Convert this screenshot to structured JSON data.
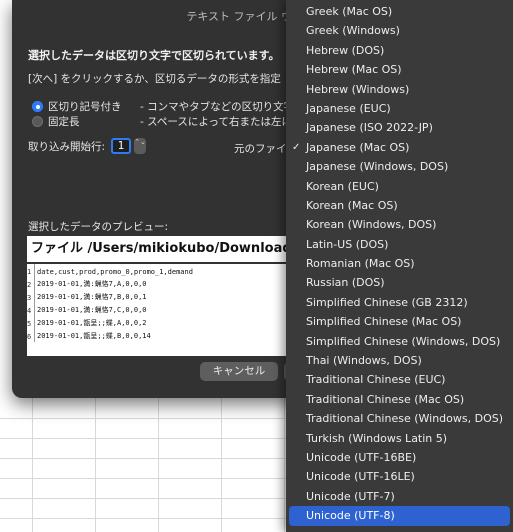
{
  "dialog": {
    "title": "テキスト ファイル ウ",
    "description_bold": "選択したデータは区切り文字で区切られています。",
    "description_line2": "[次へ] をクリックするか、区切るデータの形式を指定",
    "radio_options": [
      {
        "label": "区切り記号付き",
        "desc": "- コンマやタブなどの区切り文字",
        "selected": true
      },
      {
        "label": "固定長",
        "desc": "- スペースによって右または左に",
        "selected": false
      }
    ],
    "start_row_label": "取り込み開始行:",
    "start_row_value": "1",
    "stepper_symbol": "⌃⌄",
    "origin_label": "元のファイル",
    "preview_label": "選択したデータのプレビュー:",
    "preview_header": "ファイル /Users/mikiokubo/Downloads/dema",
    "preview_rows": [
      {
        "num": "1",
        "text": "date,cust,prod,promo_0,promo_1,demand"
      },
      {
        "num": "2",
        "text": "2019-01-01,満:蝋恪7,A,0,0,0"
      },
      {
        "num": "3",
        "text": "2019-01-01,満:蝋恪7,B,0,0,1"
      },
      {
        "num": "4",
        "text": "2019-01-01,満:蝋恪7,C,0,0,0"
      },
      {
        "num": "5",
        "text": "2019-01-01,甑呈;;蝶,A,0,0,2"
      },
      {
        "num": "6",
        "text": "2019-01-01,甑呈;;蝶,B,0,0,14"
      }
    ],
    "cancel_label": "キャンセル"
  },
  "menu": {
    "checkmark": "✓",
    "items": [
      {
        "label": "Greek (Mac OS)",
        "checked": false,
        "selected": false
      },
      {
        "label": "Greek (Windows)",
        "checked": false,
        "selected": false
      },
      {
        "label": "Hebrew (DOS)",
        "checked": false,
        "selected": false
      },
      {
        "label": "Hebrew (Mac OS)",
        "checked": false,
        "selected": false
      },
      {
        "label": "Hebrew (Windows)",
        "checked": false,
        "selected": false
      },
      {
        "label": "Japanese (EUC)",
        "checked": false,
        "selected": false
      },
      {
        "label": "Japanese (ISO 2022-JP)",
        "checked": false,
        "selected": false
      },
      {
        "label": "Japanese (Mac OS)",
        "checked": true,
        "selected": false
      },
      {
        "label": "Japanese (Windows, DOS)",
        "checked": false,
        "selected": false
      },
      {
        "label": "Korean (EUC)",
        "checked": false,
        "selected": false
      },
      {
        "label": "Korean (Mac OS)",
        "checked": false,
        "selected": false
      },
      {
        "label": "Korean (Windows, DOS)",
        "checked": false,
        "selected": false
      },
      {
        "label": "Latin-US (DOS)",
        "checked": false,
        "selected": false
      },
      {
        "label": "Romanian (Mac OS)",
        "checked": false,
        "selected": false
      },
      {
        "label": "Russian (DOS)",
        "checked": false,
        "selected": false
      },
      {
        "label": "Simplified Chinese (GB 2312)",
        "checked": false,
        "selected": false
      },
      {
        "label": "Simplified Chinese (Mac OS)",
        "checked": false,
        "selected": false
      },
      {
        "label": "Simplified Chinese (Windows, DOS)",
        "checked": false,
        "selected": false
      },
      {
        "label": "Thai (Windows, DOS)",
        "checked": false,
        "selected": false
      },
      {
        "label": "Traditional Chinese (EUC)",
        "checked": false,
        "selected": false
      },
      {
        "label": "Traditional Chinese (Mac OS)",
        "checked": false,
        "selected": false
      },
      {
        "label": "Traditional Chinese (Windows, DOS)",
        "checked": false,
        "selected": false
      },
      {
        "label": "Turkish (Windows Latin 5)",
        "checked": false,
        "selected": false
      },
      {
        "label": "Unicode (UTF-16BE)",
        "checked": false,
        "selected": false
      },
      {
        "label": "Unicode (UTF-16LE)",
        "checked": false,
        "selected": false
      },
      {
        "label": "Unicode (UTF-7)",
        "checked": false,
        "selected": false
      },
      {
        "label": "Unicode (UTF-8)",
        "checked": false,
        "selected": true
      }
    ]
  },
  "colors": {
    "accent": "#2d7cf6",
    "menu_highlight": "#2d62d0",
    "dialog_bg": "#323232",
    "menu_bg": "#3a3a3a"
  }
}
